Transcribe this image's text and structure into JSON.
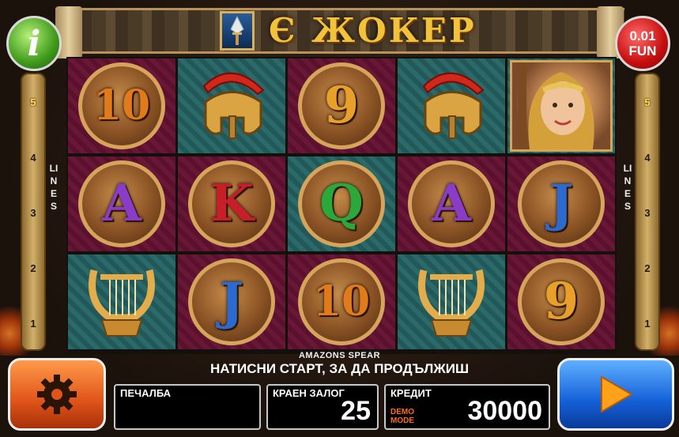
{
  "header": {
    "logo_text": "Є ЖОКЕР",
    "info_icon": "i",
    "fun_bet": "0.01",
    "fun_label": "FUN"
  },
  "lines": {
    "word": "LINES",
    "numbers": [
      "5",
      "4",
      "3",
      "2",
      "1"
    ],
    "active": "5"
  },
  "reels": [
    [
      {
        "type": "number",
        "text": "10",
        "bg": "magenta"
      },
      {
        "type": "letter",
        "text": "A",
        "bg": "magenta"
      },
      {
        "type": "lyre",
        "bg": "teal"
      }
    ],
    [
      {
        "type": "helmet",
        "bg": "teal"
      },
      {
        "type": "letter",
        "text": "K",
        "bg": "magenta"
      },
      {
        "type": "letter",
        "text": "J",
        "bg": "magenta"
      }
    ],
    [
      {
        "type": "number",
        "text": "9",
        "bg": "magenta"
      },
      {
        "type": "letter",
        "text": "Q",
        "bg": "teal"
      },
      {
        "type": "number",
        "text": "10",
        "bg": "magenta"
      }
    ],
    [
      {
        "type": "helmet",
        "bg": "teal"
      },
      {
        "type": "letter",
        "text": "A",
        "bg": "magenta"
      },
      {
        "type": "lyre",
        "bg": "teal"
      }
    ],
    [
      {
        "type": "amazon",
        "bg": "teal"
      },
      {
        "type": "letter",
        "text": "J",
        "bg": "magenta"
      },
      {
        "type": "number",
        "text": "9",
        "bg": "magenta"
      }
    ]
  ],
  "bottom": {
    "game_name": "AMAZONS SPEAR",
    "message": "НАТИСНИ СТАРТ, ЗА ДА ПРОДЪЛЖИШ",
    "win_label": "ПЕЧАЛБА",
    "win_value": "",
    "bet_label": "КРАЕН ЗАЛОГ",
    "bet_value": "25",
    "credit_label": "КРЕДИТ",
    "credit_value": "30000",
    "demo_line1": "DEMO",
    "demo_line2": "MODE"
  },
  "icons": {
    "settings": "gear-icon",
    "start": "play-icon",
    "spear": "spear-icon"
  },
  "colors": {
    "info_button": "#3f9a1b",
    "fun_button": "#c70e0e",
    "settings_button": "#e0541a",
    "start_button": "#1460d8",
    "logo": "#f2c23a"
  }
}
